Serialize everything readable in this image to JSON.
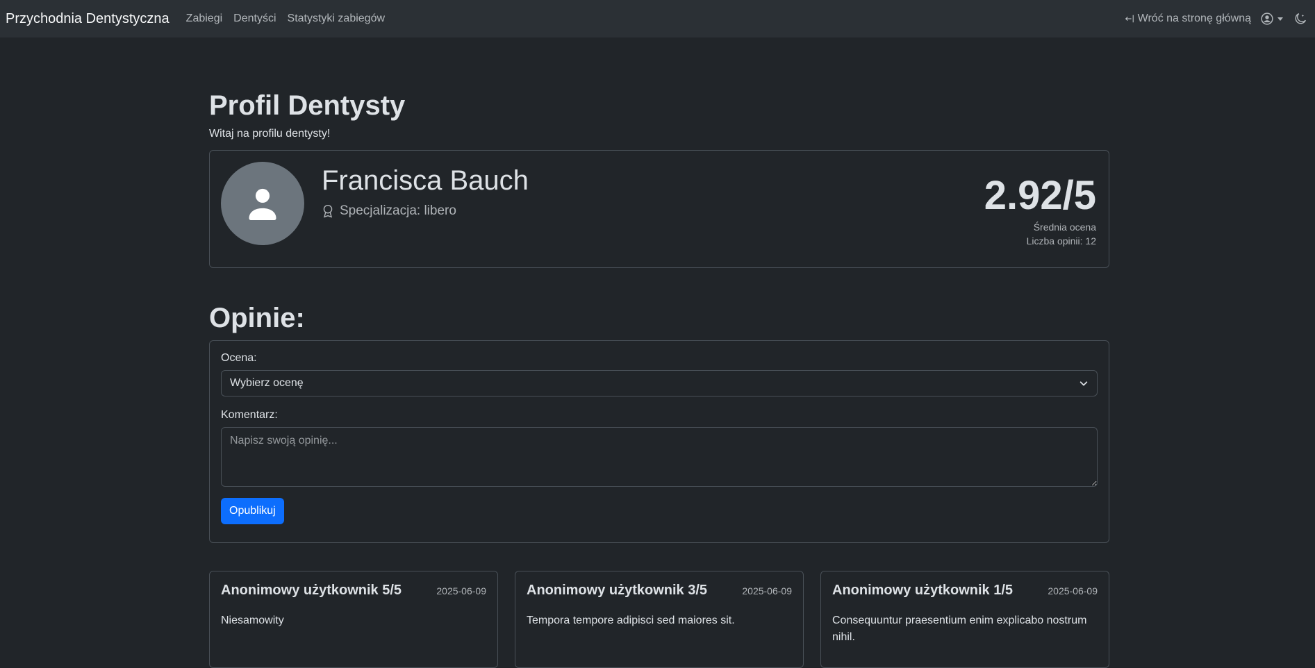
{
  "navbar": {
    "brand": "Przychodnia Dentystyczna",
    "links": [
      "Zabiegi",
      "Dentyści",
      "Statystyki zabiegów"
    ],
    "home_link": "Wróć na stronę główną"
  },
  "page": {
    "title": "Profil Dentysty",
    "subtitle": "Witaj na profilu dentysty!"
  },
  "profile": {
    "name": "Francisca Bauch",
    "specialization": "Specjalizacja: libero",
    "rating": "2.92/5",
    "rating_label": "Średnia ocena",
    "reviews_count": "Liczba opinii: 12"
  },
  "opinions": {
    "title": "Opinie:",
    "rating_label": "Ocena:",
    "rating_select_value": "Wybierz ocenę",
    "comment_label": "Komentarz:",
    "comment_placeholder": "Napisz swoją opinię...",
    "submit_label": "Opublikuj"
  },
  "reviews": [
    {
      "author": "Anonimowy użytkownik 5/5",
      "date": "2025-06-09",
      "text": "Niesamowity"
    },
    {
      "author": "Anonimowy użytkownik 3/5",
      "date": "2025-06-09",
      "text": "Tempora tempore adipisci sed maiores sit."
    },
    {
      "author": "Anonimowy użytkownik 1/5",
      "date": "2025-06-09",
      "text": "Consequuntur praesentium enim explicabo nostrum nihil."
    }
  ],
  "colors": {
    "background": "#212529",
    "navbar": "#2b3035",
    "primary": "#0d6efd",
    "avatar": "#6c757d"
  },
  "icons": {
    "home_link": "box-arrow-left-icon",
    "user_menu": "person-circle-icon",
    "theme_toggle": "moon-stars-icon",
    "avatar": "person-fill-icon",
    "specialization": "award-icon",
    "select": "chevron-down-icon"
  }
}
